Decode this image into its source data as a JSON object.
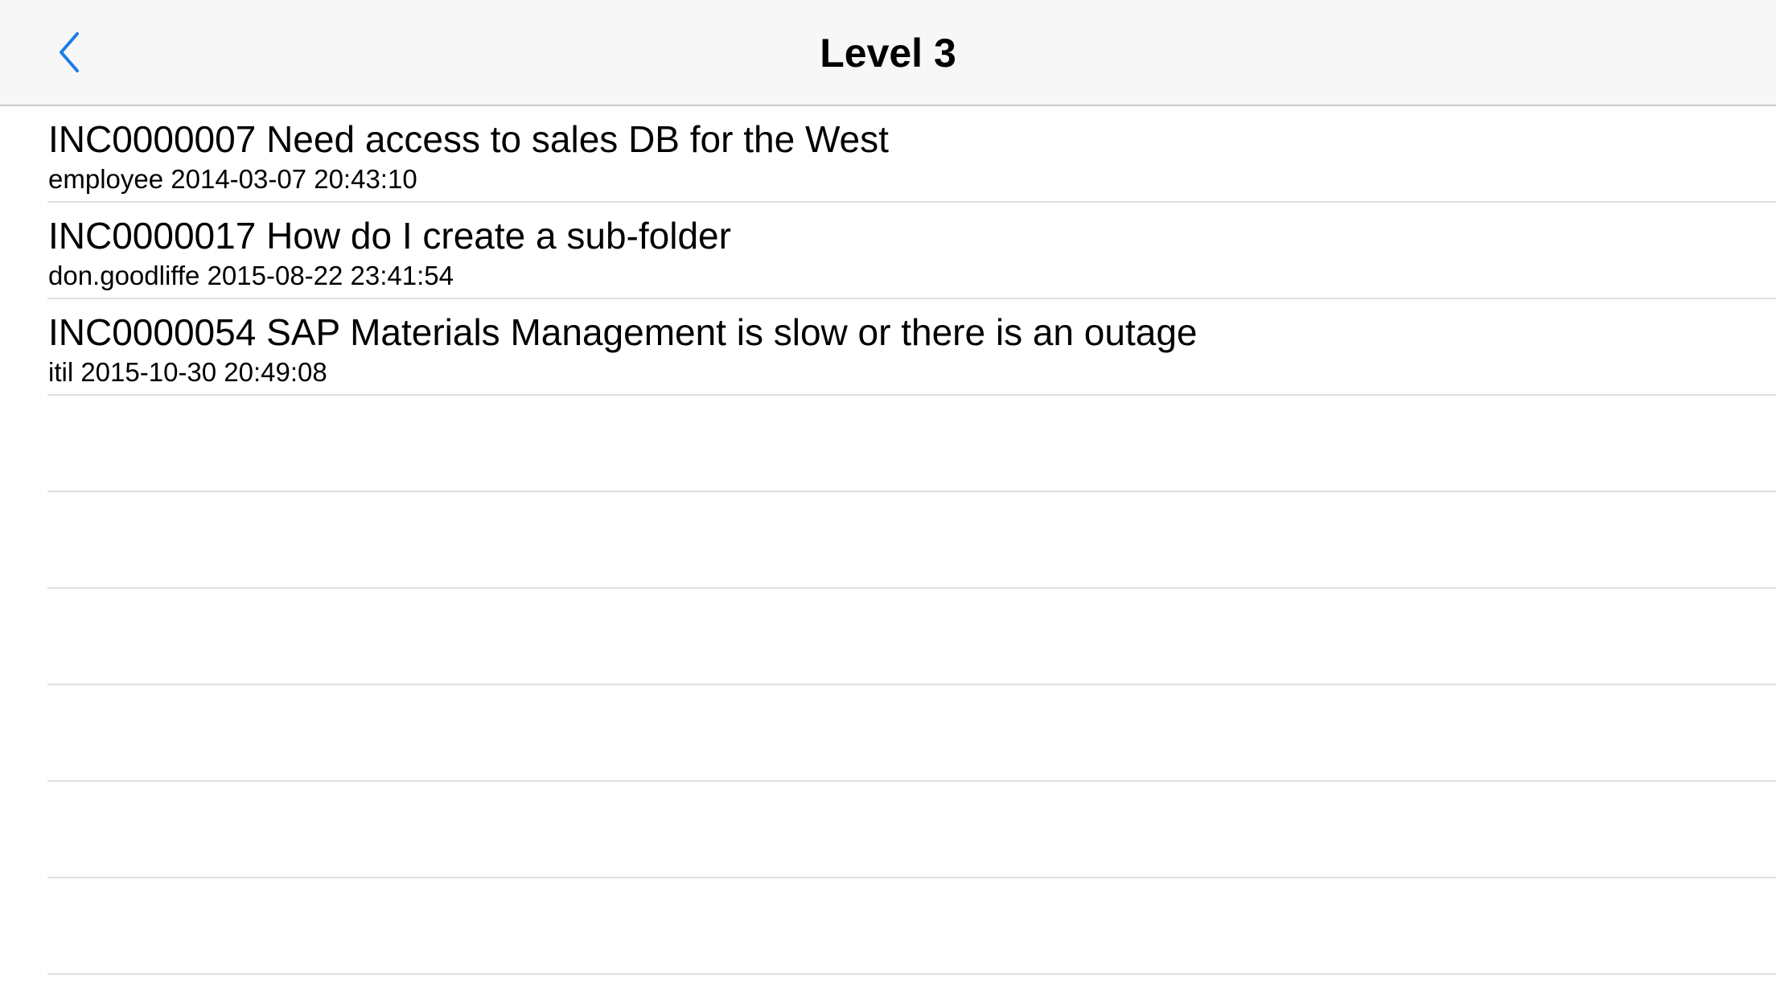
{
  "navbar": {
    "title": "Level 3",
    "back_icon": "chevron-left-icon",
    "accent_color": "#1a7ce6"
  },
  "incidents": [
    {
      "title": "INC0000007 Need access to sales DB for the West",
      "subtitle": "employee 2014-03-07 20:43:10"
    },
    {
      "title": "INC0000017 How do I create a sub-folder",
      "subtitle": "don.goodliffe 2015-08-22 23:41:54"
    },
    {
      "title": "INC0000054 SAP Materials Management is slow or there is an outage",
      "subtitle": "itil 2015-10-30 20:49:08"
    }
  ],
  "empty_rows": 6
}
